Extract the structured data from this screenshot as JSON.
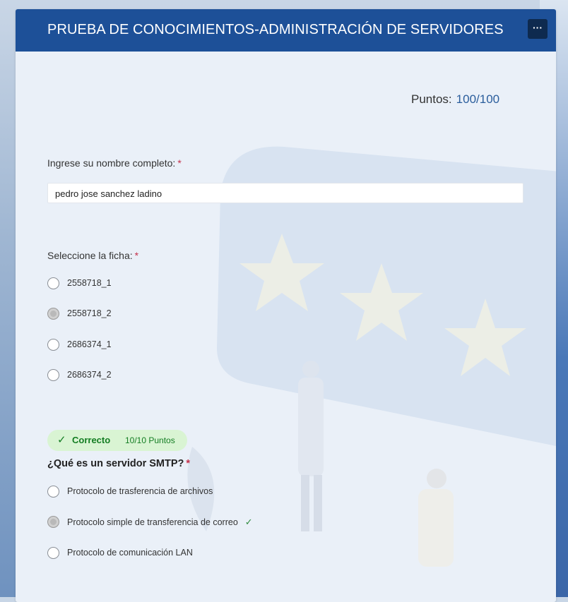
{
  "header": {
    "title": "PRUEBA DE CONOCIMIENTOS-ADMINISTRACIÓN DE SERVIDORES",
    "more_label": "···"
  },
  "score": {
    "label": "Puntos:",
    "value": "100/100"
  },
  "q1": {
    "label": "Ingrese su nombre completo:",
    "required": "*",
    "value": "pedro jose sanchez ladino"
  },
  "q2": {
    "label": "Seleccione la ficha:",
    "required": "*",
    "options": [
      "2558718_1",
      "2558718_2",
      "2686374_1",
      "2686374_2"
    ],
    "selected": "2558718_2"
  },
  "q3": {
    "badge": {
      "title": "Correcto",
      "points": "10/10 Puntos"
    },
    "label": "¿Qué es un servidor SMTP?",
    "required": "*",
    "options": [
      "Protocolo de trasferencia de archivos",
      "Protocolo simple de transferencia de correo",
      "Protocolo de comunicación LAN"
    ],
    "selected": "Protocolo simple de transferencia de correo",
    "correct_mark": "✓"
  },
  "colors": {
    "header": "#1d5098",
    "accent": "#2a5d9c",
    "required": "#c4314b",
    "correct_bg": "#d9f4d3",
    "correct_text": "#137d22"
  }
}
